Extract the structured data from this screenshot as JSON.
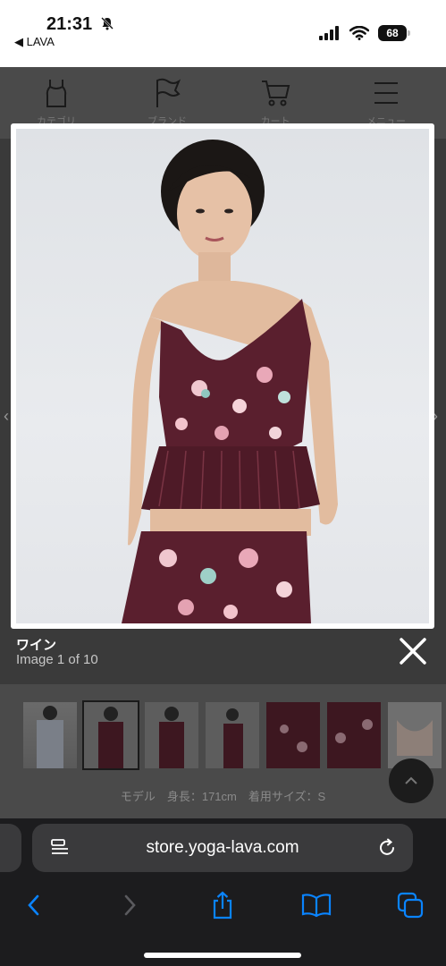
{
  "status": {
    "time": "21:31",
    "back_app": "◀ LAVA",
    "battery": "68"
  },
  "site_nav": {
    "items": [
      "カテゴリ",
      "ブランド",
      "カート",
      "メニュー"
    ]
  },
  "lightbox": {
    "title": "ワイン",
    "counter": "Image 1 of 10"
  },
  "product": {
    "model_info": "モデル　身長：171cm　着用サイズ：S"
  },
  "safari": {
    "url": "store.yoga-lava.com"
  },
  "colors": {
    "wine": "#5a1f2e",
    "accent": "#0a84ff"
  }
}
